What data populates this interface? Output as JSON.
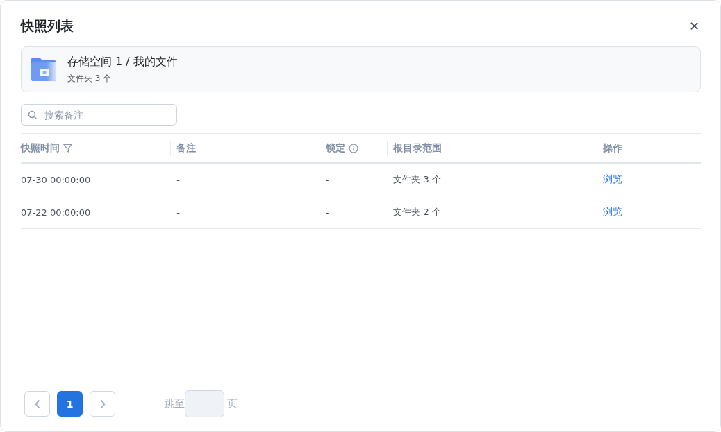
{
  "dialog": {
    "title": "快照列表",
    "close_label": "✕"
  },
  "location": {
    "path": "存储空间 1 / 我的文件",
    "summary": "文件夹 3 个"
  },
  "search": {
    "placeholder": "搜索备注"
  },
  "table": {
    "columns": [
      {
        "label": "快照时间",
        "kind": "filter"
      },
      {
        "label": "备注",
        "kind": "plain"
      },
      {
        "label": "锁定",
        "kind": "info"
      },
      {
        "label": "根目录范围",
        "kind": "plain"
      },
      {
        "label": "操作",
        "kind": "plain"
      }
    ],
    "rows": [
      {
        "cells": [
          "07-30 00:00:00",
          "-",
          "-",
          "文件夹 3 个"
        ],
        "action": "浏览"
      },
      {
        "cells": [
          "07-22 00:00:00",
          "-",
          "-",
          "文件夹 2 个"
        ],
        "action": "浏览"
      }
    ]
  },
  "pagination": {
    "pages": [
      {
        "label": "1",
        "selected": true
      }
    ],
    "jump_label": "跳至",
    "page_unit": "页"
  }
}
